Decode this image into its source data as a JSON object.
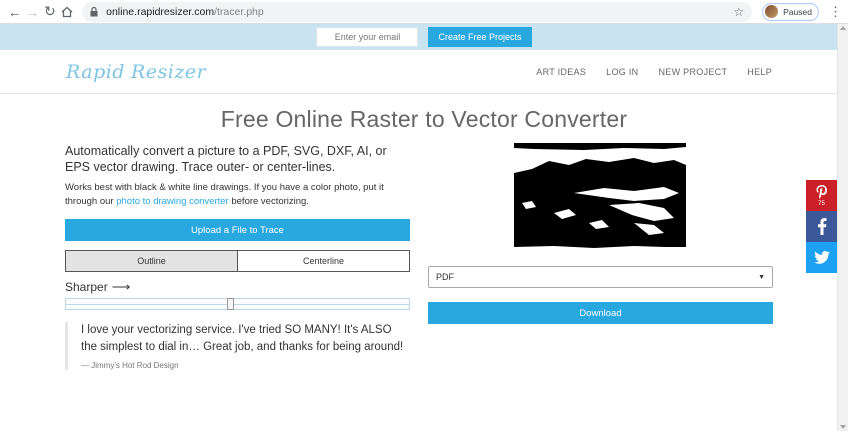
{
  "browser": {
    "url_host": "online.rapidresizer.com",
    "url_path": "/tracer.php",
    "profile_label": "Paused"
  },
  "promo": {
    "email_placeholder": "Enter your email",
    "create_button": "Create Free Projects"
  },
  "header": {
    "logo_part1": "Rapid",
    "logo_part2": "Resizer",
    "menu": [
      "ART IDEAS",
      "LOG IN",
      "NEW PROJECT",
      "HELP"
    ]
  },
  "main": {
    "title": "Free Online Raster to Vector Converter",
    "lead": "Automatically convert a picture to a PDF, SVG, DXF, AI, or EPS vector drawing. Trace outer- or center-lines.",
    "sub_before": "Works best with black & white line drawings. If you have a color photo, put it through our ",
    "sub_link": "photo to drawing converter",
    "sub_after": " before vectorizing.",
    "upload_button": "Upload a File to Trace",
    "toggle": {
      "outline": "Outline",
      "centerline": "Centerline",
      "active": "outline"
    },
    "slider_label": "Sharper",
    "slider_value": 0.48,
    "quote_text": "I love your vectorizing service. I've tried SO MANY! It's ALSO the simplest to dial in… Great job, and thanks for being around!",
    "quote_cite": "— Jimmy's Hot Rod Design"
  },
  "output": {
    "format_selected": "PDF",
    "download_button": "Download"
  },
  "social": {
    "pinterest_count": "75"
  },
  "colors": {
    "accent": "#29a8e0",
    "promo_bg": "#c9e3f1",
    "pinterest": "#cb2027",
    "facebook": "#3b5998",
    "twitter": "#1da1f2"
  }
}
